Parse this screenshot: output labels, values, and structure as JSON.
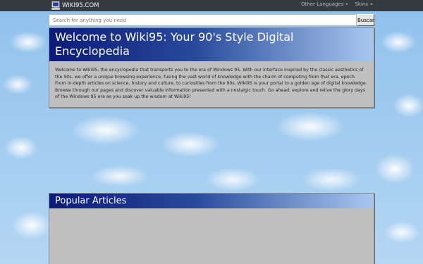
{
  "navbar": {
    "brand": "WIKI95.COM",
    "brand_icon": "computer-icon",
    "links": [
      {
        "label": "Other Languages",
        "icon": "caret-down-icon"
      },
      {
        "label": "Skins",
        "icon": "caret-down-icon"
      }
    ]
  },
  "search": {
    "placeholder": "Search for anything you need",
    "button_label": "Buscar"
  },
  "welcome": {
    "title": "Welcome to Wiki95: Your 90's Style Digital Encyclopedia",
    "body": "Welcome to Wiki95, the encyclopedia that transports you to the era of Windows 95. With our interface inspired by the classic aesthetics of the 90s, we offer a unique browsing experience, fusing the vast world of knowledge with the charm of computing from that era. epoch. From in-depth articles on science, history and culture, to curiosities from the 90s, Wiki95 is your portal to a golden age of digital knowledge. Browse through our pages and discover valuable information presented with a nostalgic touch. Go ahead, explore and relive the glory days of the Windows 95 era as you soak up the wisdom at Wiki95!"
  },
  "popular": {
    "title": "Popular Articles"
  },
  "colors": {
    "navbar_bg": "#343a40",
    "panel_bg": "#c0c0c0",
    "title_gradient_start": "#0c1a78",
    "title_gradient_end": "#a9c8ef"
  }
}
